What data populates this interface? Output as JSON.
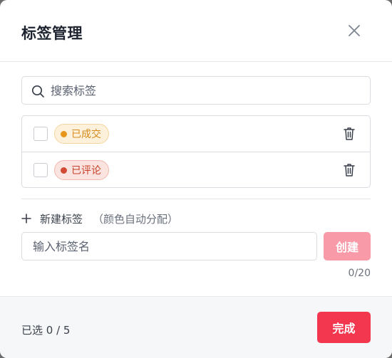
{
  "dialog": {
    "title": "标签管理"
  },
  "search": {
    "placeholder": "搜索标签"
  },
  "tags": [
    {
      "label": "已成交",
      "text_color": "#d88a1b",
      "bg_color": "#fdf1dc",
      "border_color": "#f5d49e",
      "dot_color": "#e8951c",
      "checked": false
    },
    {
      "label": "已评论",
      "text_color": "#c8402b",
      "bg_color": "#fbe4df",
      "border_color": "#f0b8ac",
      "dot_color": "#d24a34",
      "checked": false
    }
  ],
  "new_tag": {
    "title": "新建标签",
    "hint": "（颜色自动分配）",
    "input_placeholder": "输入标签名",
    "create_label": "创建",
    "counter": "0/20"
  },
  "footer": {
    "selected_text": "已选 0 / 5",
    "done_label": "完成"
  },
  "colors": {
    "accent": "#f2374f",
    "accent_disabled": "#f99aa8"
  },
  "icons": {
    "close": "close-icon",
    "search": "search-icon",
    "delete": "trash-icon",
    "add": "plus-icon"
  }
}
